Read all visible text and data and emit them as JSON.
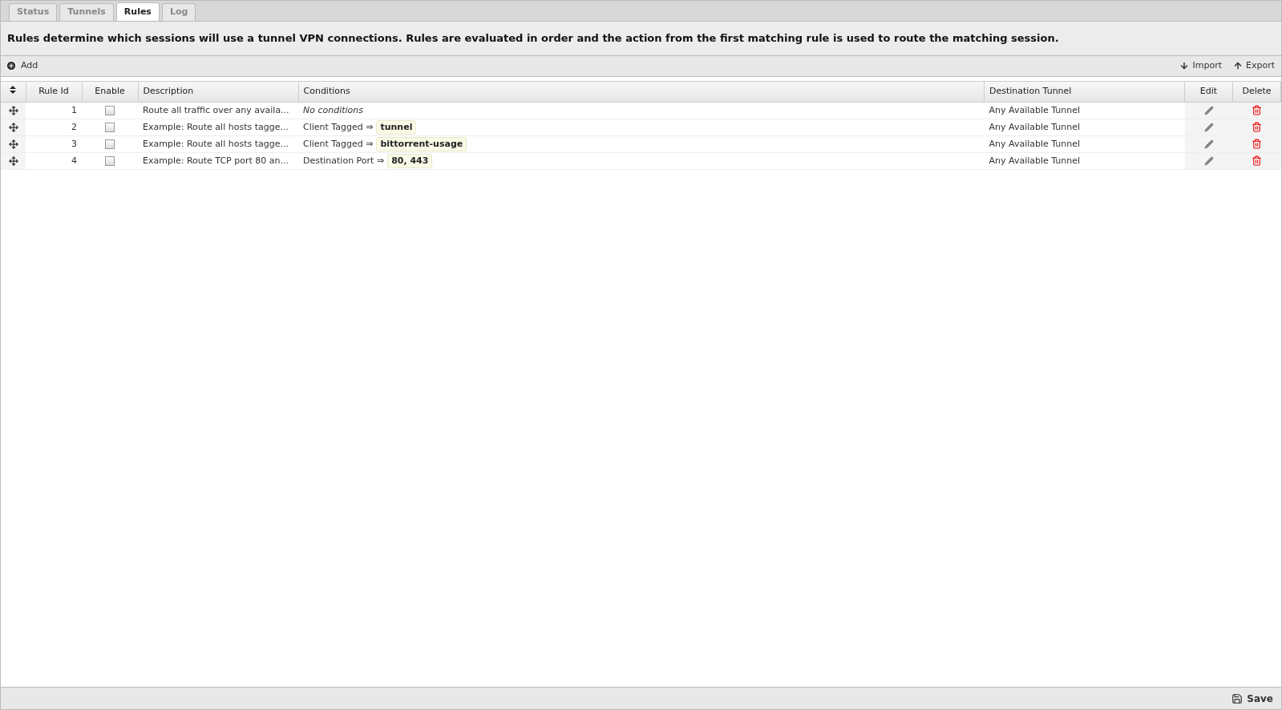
{
  "tabs": [
    {
      "label": "Status",
      "selected": false
    },
    {
      "label": "Tunnels",
      "selected": false
    },
    {
      "label": "Rules",
      "selected": true
    },
    {
      "label": "Log",
      "selected": false
    }
  ],
  "intro": "Rules determine which sessions will use a tunnel VPN connections. Rules are evaluated in order and the action from the first matching rule is used to route the matching session.",
  "toolbar": {
    "add": "Add",
    "import": "Import",
    "export": "Export"
  },
  "table": {
    "columns": [
      "Rule Id",
      "Enable",
      "Description",
      "Conditions",
      "Destination Tunnel",
      "Edit",
      "Delete"
    ],
    "rows": [
      {
        "rule_id": "1",
        "enabled": false,
        "description": "Route all traffic over any availa...",
        "condition": {
          "kind": "none",
          "text": "No conditions"
        },
        "destination": "Any Available Tunnel"
      },
      {
        "rule_id": "2",
        "enabled": false,
        "description": "Example: Route all hosts tagge...",
        "condition": {
          "kind": "tag",
          "text": "Client Tagged ⇒",
          "value": "tunnel"
        },
        "destination": "Any Available Tunnel"
      },
      {
        "rule_id": "3",
        "enabled": false,
        "description": "Example: Route all hosts tagge...",
        "condition": {
          "kind": "tag",
          "text": "Client Tagged ⇒",
          "value": "bittorrent-usage"
        },
        "destination": "Any Available Tunnel"
      },
      {
        "rule_id": "4",
        "enabled": false,
        "description": "Example: Route TCP port 80 an...",
        "condition": {
          "kind": "tag",
          "text": "Destination Port ⇒",
          "value": "80, 443"
        },
        "destination": "Any Available Tunnel"
      }
    ]
  },
  "footer": {
    "save": "Save"
  }
}
